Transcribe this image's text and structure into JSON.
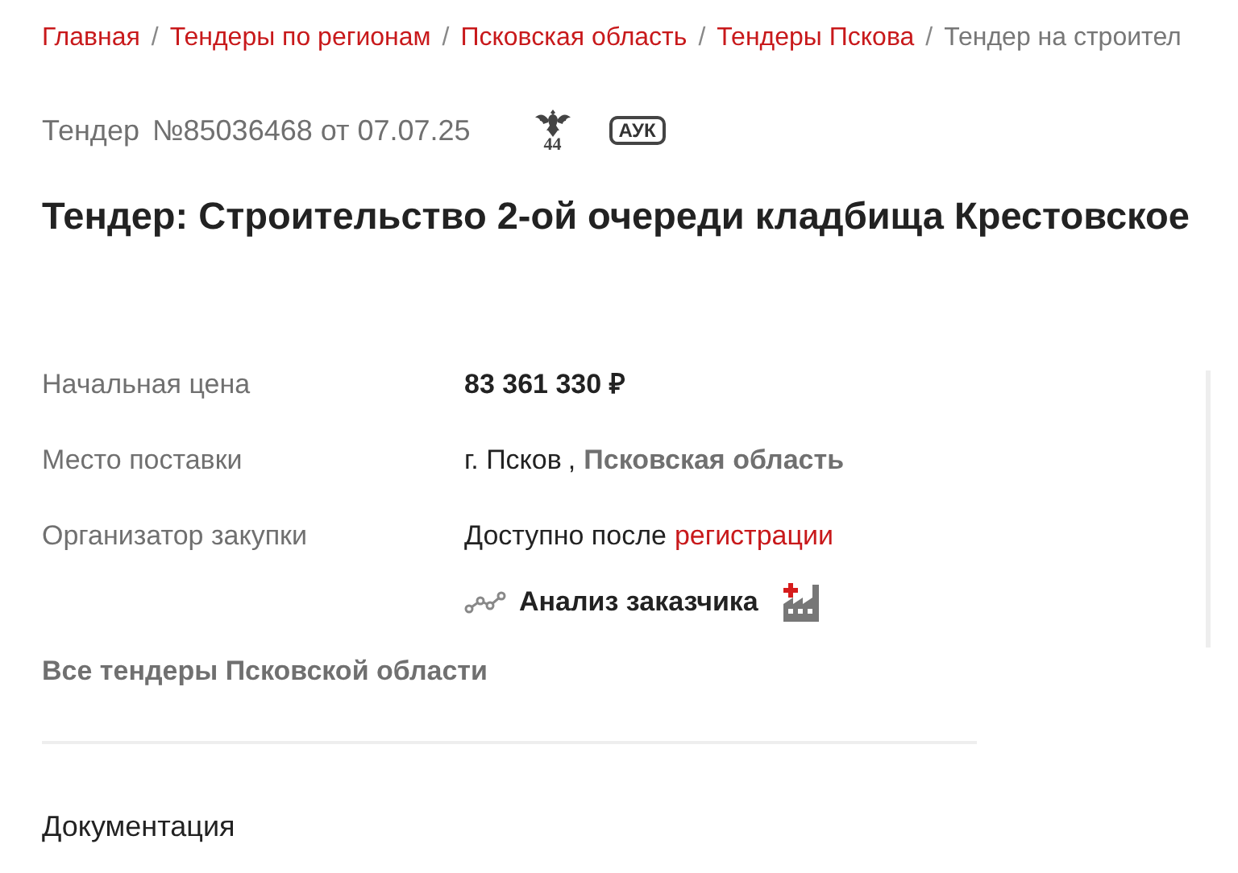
{
  "breadcrumb": [
    {
      "label": "Главная",
      "link": true
    },
    {
      "label": "Тендеры по регионам",
      "link": true
    },
    {
      "label": "Псковская область",
      "link": true
    },
    {
      "label": "Тендеры Пскова",
      "link": true
    },
    {
      "label": "Тендер на строител",
      "link": false
    }
  ],
  "separator": "/",
  "tender_header": {
    "label": "Тендер",
    "number": "№85036468 от 07.07.25",
    "law": "44",
    "badge": "АУК"
  },
  "title": "Тендер: Строительство 2-ой очереди кладбища Крестовское",
  "fields": [
    {
      "kind": "price",
      "label": "Начальная цена",
      "value": "83 361 330 ₽"
    },
    {
      "kind": "place",
      "label": "Место поставки",
      "city": "г. Псков",
      "separator": ",",
      "region": "Псковская область"
    },
    {
      "kind": "locked",
      "label": "Организатор закупки",
      "text": "Доступно после",
      "link": "регистрации"
    }
  ],
  "analysis_link": "Анализ заказчика",
  "region_link": "Все тендеры Псковской области",
  "section": "Документация"
}
